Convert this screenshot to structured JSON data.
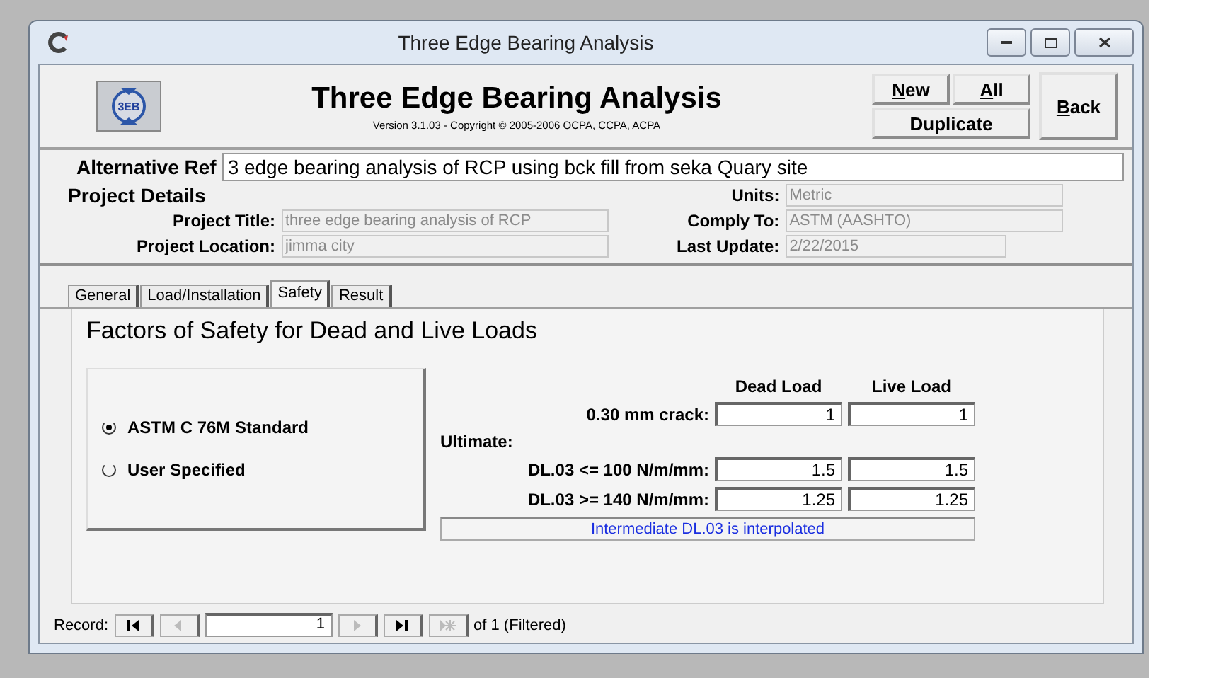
{
  "window": {
    "title": "Three Edge Bearing Analysis"
  },
  "header": {
    "logo": "3EB",
    "title": "Three Edge Bearing Analysis",
    "version": "Version 3.1.03 - Copyright © 2005-2006 OCPA, CCPA, ACPA"
  },
  "buttons": {
    "grid": [
      {
        "label": "New",
        "underline_first": true
      },
      {
        "label": "All",
        "underline_first": true
      },
      {
        "label": "Duplicate",
        "underline_first": false
      }
    ],
    "side": [
      {
        "label": "Back",
        "underline_first": true
      }
    ]
  },
  "alternative_ref": {
    "label": "Alternative Ref",
    "value": "3 edge bearing  analysis  of RCP using bck fill from seka Quary site"
  },
  "project_details": {
    "heading": "Project Details",
    "left": [
      {
        "label": "Project Title:",
        "value": "three edge bearing analysis of RCP",
        "disabled": true
      },
      {
        "label": "Project Location:",
        "value": "jimma city",
        "disabled": true
      }
    ],
    "right": [
      {
        "label": "Units:",
        "value": "Metric",
        "disabled": true
      },
      {
        "label": "Comply To:",
        "value": "ASTM (AASHTO)",
        "disabled": true
      },
      {
        "label": "Last Update:",
        "value": "2/22/2015",
        "disabled": true
      }
    ]
  },
  "tabs": [
    {
      "label": "General",
      "selected": false
    },
    {
      "label": "Load/Installation",
      "selected": false
    },
    {
      "label": "Safety",
      "selected": true
    },
    {
      "label": "Result",
      "selected": false
    }
  ],
  "safety": {
    "heading": "Factors of Safety for Dead and Live Loads",
    "options": [
      {
        "label": "ASTM C 76M Standard",
        "selected": true
      },
      {
        "label": "User Specified",
        "selected": false
      }
    ],
    "columns": [
      "Dead Load",
      "Live Load"
    ],
    "rows": [
      {
        "kind": "values",
        "label": "0.30 mm crack:",
        "values": [
          "1",
          "1"
        ]
      },
      {
        "kind": "heading",
        "label": "Ultimate:"
      },
      {
        "kind": "values",
        "label": "DL.03 <= 100 N/m/mm:",
        "values": [
          "1.5",
          "1.5"
        ]
      },
      {
        "kind": "values",
        "label": "DL.03 >= 140 N/m/mm:",
        "values": [
          "1.25",
          "1.25"
        ]
      }
    ],
    "note": "Intermediate DL.03 is interpolated"
  },
  "record_nav": {
    "label": "Record:",
    "value": "1",
    "of": "of  1 (Filtered)",
    "buttons": [
      {
        "kind": "first",
        "disabled": false
      },
      {
        "kind": "prev",
        "disabled": true
      },
      {
        "kind": "field"
      },
      {
        "kind": "next",
        "disabled": true
      },
      {
        "kind": "last",
        "disabled": false
      },
      {
        "kind": "new",
        "disabled": true
      }
    ]
  }
}
